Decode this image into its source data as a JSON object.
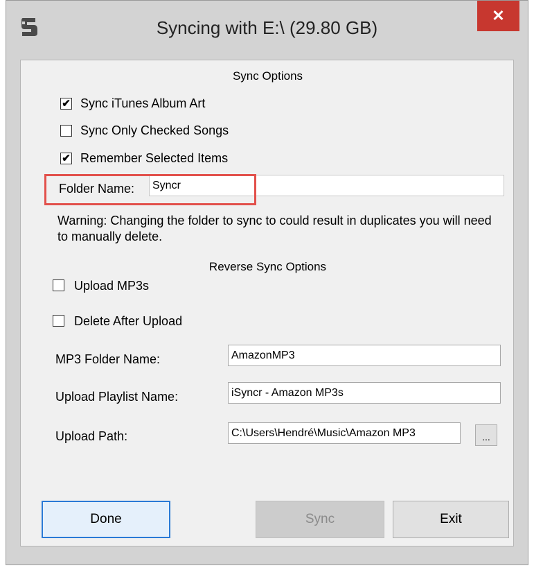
{
  "window": {
    "title": "Syncing with E:\\ (29.80 GB)",
    "close_glyph": "✕"
  },
  "sync_options": {
    "heading": "Sync Options",
    "checkboxes": [
      {
        "label": "Sync iTunes Album Art",
        "checked": true
      },
      {
        "label": "Sync Only Checked Songs",
        "checked": false
      },
      {
        "label": "Remember Selected Items",
        "checked": true
      }
    ],
    "folder_name_label": "Folder Name:",
    "folder_name_value": "Syncr",
    "warning": "Warning: Changing the folder to sync to could result in duplicates you will need to manually delete."
  },
  "reverse_sync": {
    "heading": "Reverse Sync Options",
    "checkboxes": [
      {
        "label": "Upload MP3s",
        "checked": false
      },
      {
        "label": "Delete After Upload",
        "checked": false
      }
    ],
    "mp3_folder_label": "MP3 Folder Name:",
    "mp3_folder_value": "AmazonMP3",
    "playlist_label": "Upload Playlist Name:",
    "playlist_value": "iSyncr - Amazon MP3s",
    "path_label": "Upload Path:",
    "path_value": "C:\\Users\\Hendré\\Music\\Amazon MP3",
    "browse_label": "..."
  },
  "buttons": {
    "done": "Done",
    "sync": "Sync",
    "exit": "Exit"
  },
  "colors": {
    "highlight": "#e2504b",
    "close": "#c7372f",
    "primary_border": "#2a7ad6"
  }
}
